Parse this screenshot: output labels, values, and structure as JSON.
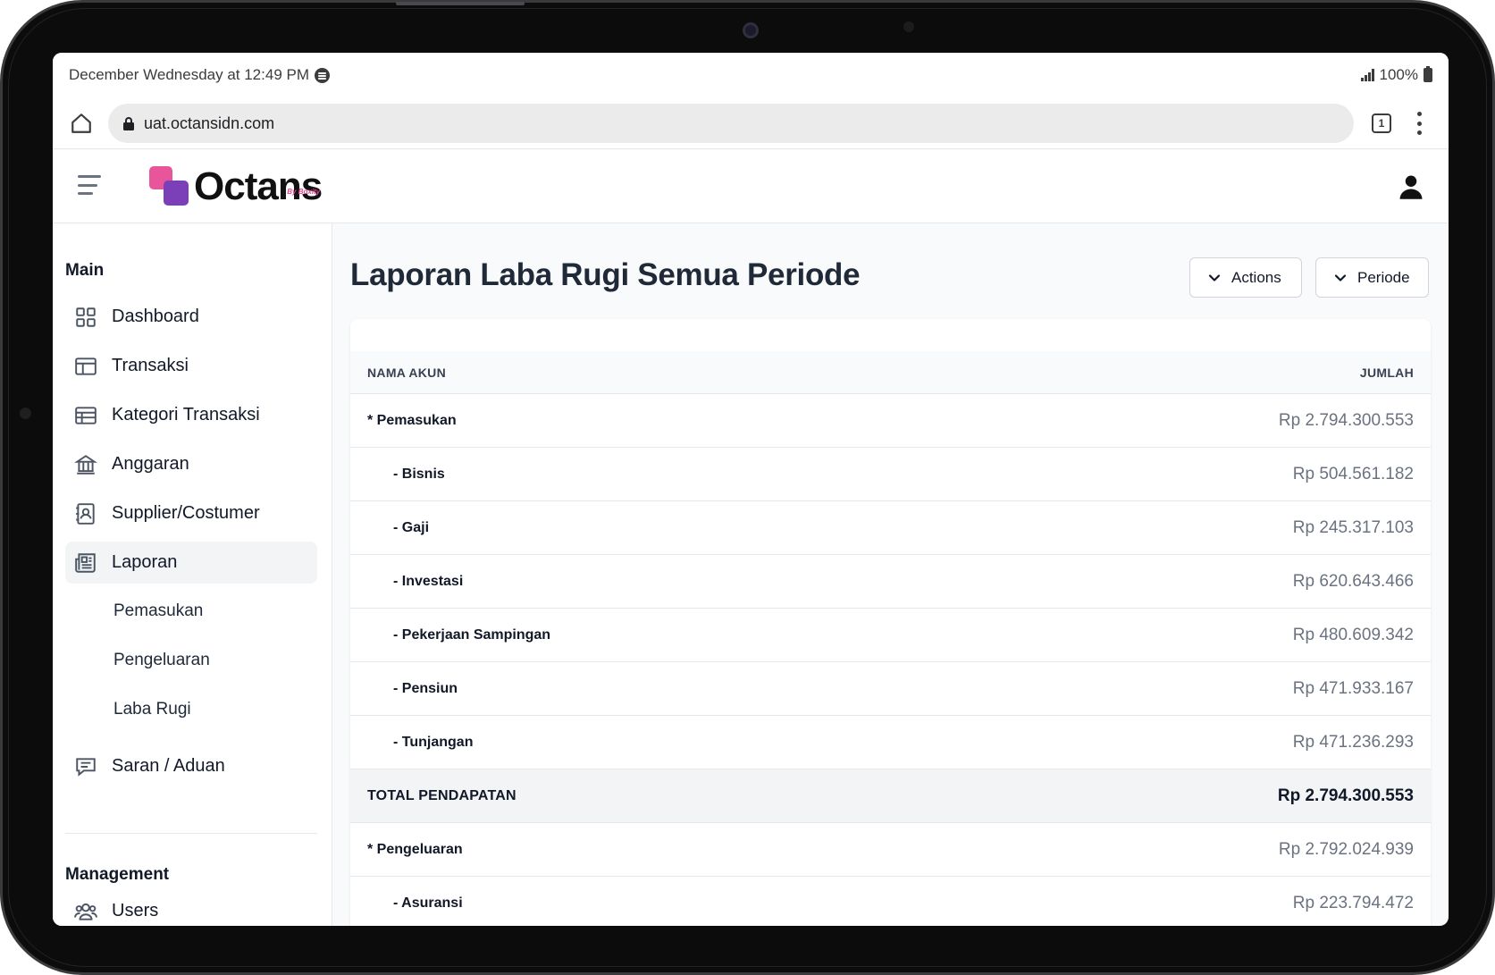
{
  "status_bar": {
    "time": "December Wednesday at 12:49 PM",
    "battery": "100%"
  },
  "browser": {
    "url": "uat.octansidn.com",
    "tab_count": "1"
  },
  "app": {
    "logo_text": "Octans",
    "logo_sub": "By Boxity"
  },
  "sidebar": {
    "main_label": "Main",
    "items": [
      {
        "label": "Dashboard",
        "icon": "dashboard-icon"
      },
      {
        "label": "Transaksi",
        "icon": "layout-icon"
      },
      {
        "label": "Kategori Transaksi",
        "icon": "table-icon"
      },
      {
        "label": "Anggaran",
        "icon": "bank-icon"
      },
      {
        "label": "Supplier/Costumer",
        "icon": "contact-book-icon"
      },
      {
        "label": "Laporan",
        "icon": "newspaper-icon"
      }
    ],
    "laporan_sub": [
      "Pemasukan",
      "Pengeluaran",
      "Laba Rugi"
    ],
    "saran": {
      "label": "Saran / Aduan",
      "icon": "message-icon"
    },
    "management_label": "Management",
    "users": {
      "label": "Users",
      "icon": "users-icon"
    }
  },
  "page": {
    "title": "Laporan Laba Rugi Semua Periode",
    "actions_label": "Actions",
    "periode_label": "Periode"
  },
  "table": {
    "col_name": "NAMA AKUN",
    "col_amount": "JUMLAH",
    "rows": [
      {
        "name": "* Pemasukan",
        "amount": "Rp 2.794.300.553"
      },
      {
        "name": "- Bisnis",
        "amount": "Rp 504.561.182"
      },
      {
        "name": "- Gaji",
        "amount": "Rp 245.317.103"
      },
      {
        "name": "- Investasi",
        "amount": "Rp 620.643.466"
      },
      {
        "name": "- Pekerjaan Sampingan",
        "amount": "Rp 480.609.342"
      },
      {
        "name": "- Pensiun",
        "amount": "Rp 471.933.167"
      },
      {
        "name": "- Tunjangan",
        "amount": "Rp 471.236.293"
      },
      {
        "name": "TOTAL PENDAPATAN",
        "amount": "Rp 2.794.300.553"
      },
      {
        "name": "* Pengeluaran",
        "amount": "Rp 2.792.024.939"
      },
      {
        "name": "- Asuransi",
        "amount": "Rp 223.794.472"
      }
    ]
  }
}
